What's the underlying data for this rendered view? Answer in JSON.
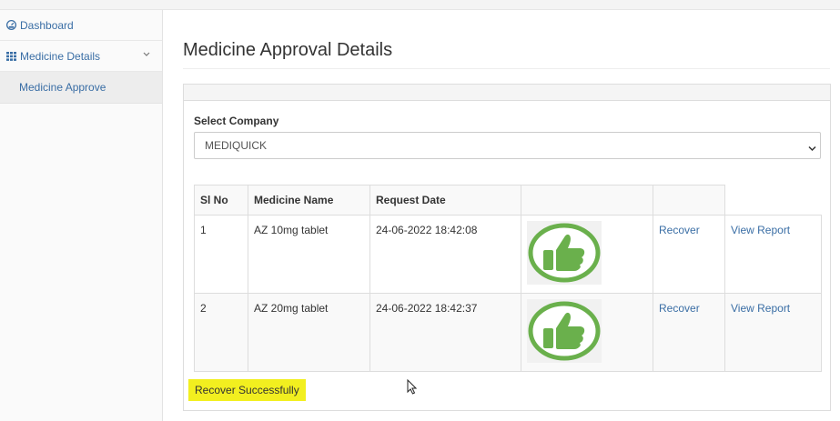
{
  "sidebar": {
    "items": [
      {
        "label": "Dashboard",
        "icon": "dashboard-icon"
      },
      {
        "label": "Medicine Details",
        "icon": "grid-icon",
        "chevron": "chevron-down-icon"
      }
    ],
    "sub_items": [
      {
        "label": "Medicine Approve"
      }
    ]
  },
  "page": {
    "title": "Medicine Approval Details"
  },
  "form": {
    "company_label": "Select Company",
    "company_value": "MEDIQUICK"
  },
  "table": {
    "headers": [
      "Sl No",
      "Medicine Name",
      "Request Date",
      "",
      ""
    ],
    "rows": [
      {
        "sl": "1",
        "name": "AZ 10mg tablet",
        "date": "24-06-2022 18:42:08",
        "image": "thumbs-up-icon",
        "action": "Recover",
        "report": "View Report"
      },
      {
        "sl": "2",
        "name": "AZ 20mg tablet",
        "date": "24-06-2022 18:42:37",
        "image": "thumbs-up-icon",
        "action": "Recover",
        "report": "View Report"
      }
    ]
  },
  "status": {
    "message": "Recover Successfully"
  },
  "colors": {
    "link": "#3a6ea5",
    "highlight": "#f2ef1f",
    "thumbs_green": "#6ab04c"
  }
}
